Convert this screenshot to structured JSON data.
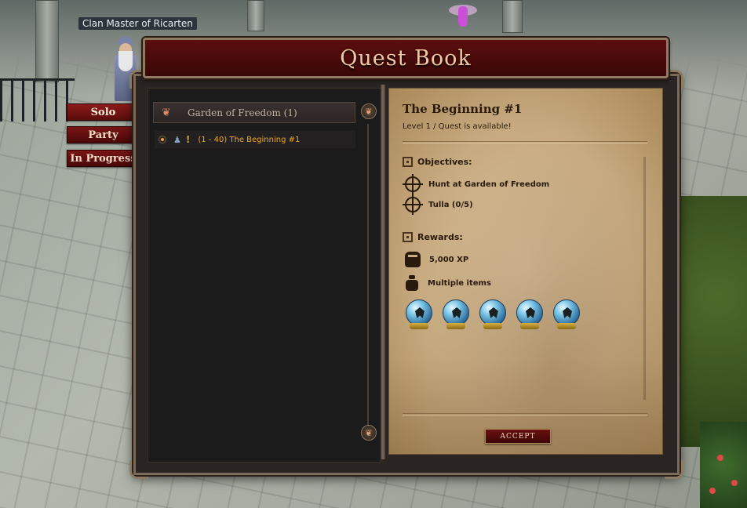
{
  "npc": {
    "name": "Clan Master of Ricarten"
  },
  "window": {
    "title": "Quest Book"
  },
  "tabs": [
    {
      "label": "Solo",
      "active": true
    },
    {
      "label": "Party",
      "active": false
    },
    {
      "label": "In Progress",
      "active": false
    }
  ],
  "quest_list": {
    "group": {
      "label": "Garden of Freedom (1)",
      "icon": "heart-icon"
    },
    "items": [
      {
        "label": "(1 - 40) The Beginning #1",
        "icons": [
          "status-dot-icon",
          "party-icon",
          "exclamation-icon"
        ]
      }
    ]
  },
  "quest_detail": {
    "title": "The Beginning #1",
    "subtitle": "Level 1 / Quest is available!",
    "objectives_header": "Objectives:",
    "objectives": [
      {
        "label": "Hunt at Garden of Freedom",
        "icon": "target-icon"
      },
      {
        "label": "Tulla (0/5)",
        "icon": "target-icon"
      }
    ],
    "rewards_header": "Rewards:",
    "rewards": [
      {
        "label": "5,000 XP",
        "icon": "fist-icon"
      },
      {
        "label": "Multiple items",
        "icon": "bag-icon"
      }
    ],
    "reward_items": [
      {
        "icon": "crystal-orb-icon"
      },
      {
        "icon": "crystal-orb-icon"
      },
      {
        "icon": "crystal-orb-icon"
      },
      {
        "icon": "crystal-orb-icon"
      },
      {
        "icon": "crystal-orb-icon"
      }
    ],
    "accept_label": "ACCEPT"
  },
  "colors": {
    "title_bar": "#5b0e0e",
    "tab": "#7a1515",
    "quest_text": "#f0a820",
    "parchment": "#c7aa80"
  }
}
